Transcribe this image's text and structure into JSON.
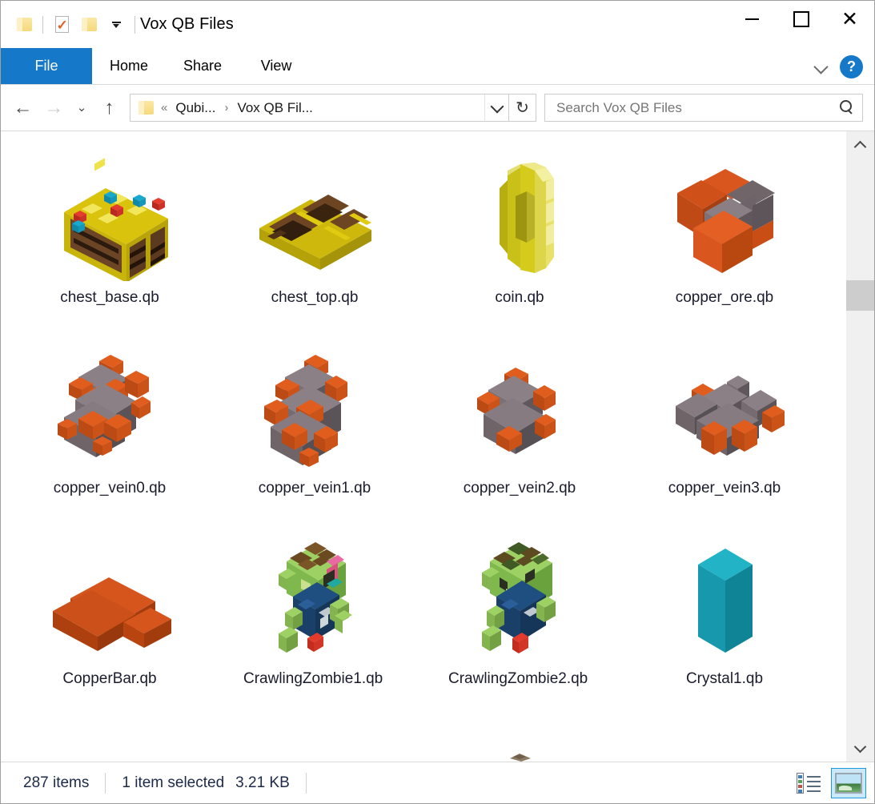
{
  "window": {
    "title": "Vox QB Files",
    "quick_access": [
      {
        "name": "folder-icon",
        "label": "Folder"
      },
      {
        "name": "properties-icon",
        "label": "Properties"
      },
      {
        "name": "new-folder-icon",
        "label": "New folder"
      },
      {
        "name": "customize-quick-access-caret",
        "label": "Customize Quick Access Toolbar"
      }
    ],
    "controls": {
      "minimize": "minimize-button",
      "maximize": "maximize-button",
      "close": "close-button"
    }
  },
  "ribbon": {
    "tabs": [
      {
        "label": "File",
        "active": true
      },
      {
        "label": "Home",
        "active": false
      },
      {
        "label": "Share",
        "active": false
      },
      {
        "label": "View",
        "active": false
      }
    ],
    "expand_label": "",
    "help_label": "?"
  },
  "navigation": {
    "back": "←",
    "forward": "→",
    "recent": "⌄",
    "up": "↑",
    "refresh": "↻"
  },
  "address": {
    "leading_chevrons": "«",
    "separator": "›",
    "crumbs": [
      "Qubi...",
      "Vox QB Fil..."
    ]
  },
  "search": {
    "placeholder": "Search Vox QB Files",
    "value": ""
  },
  "files": [
    {
      "name": "chest_base.qb",
      "icon": "voxel-chest-base",
      "selected": false
    },
    {
      "name": "chest_top.qb",
      "icon": "voxel-chest-top",
      "selected": false
    },
    {
      "name": "coin.qb",
      "icon": "voxel-coin",
      "selected": false
    },
    {
      "name": "copper_ore.qb",
      "icon": "voxel-copper-ore",
      "selected": false
    },
    {
      "name": "copper_vein0.qb",
      "icon": "voxel-copper-vein0",
      "selected": false
    },
    {
      "name": "copper_vein1.qb",
      "icon": "voxel-copper-vein1",
      "selected": false
    },
    {
      "name": "copper_vein2.qb",
      "icon": "voxel-copper-vein2",
      "selected": false
    },
    {
      "name": "copper_vein3.qb",
      "icon": "voxel-copper-vein3",
      "selected": false
    },
    {
      "name": "CopperBar.qb",
      "icon": "voxel-copper-bar",
      "selected": false
    },
    {
      "name": "CrawlingZombie1.qb",
      "icon": "voxel-zombie-1",
      "selected": false
    },
    {
      "name": "CrawlingZombie2.qb",
      "icon": "voxel-zombie-2",
      "selected": false
    },
    {
      "name": "Crystal1.qb",
      "icon": "voxel-crystal",
      "selected": false
    }
  ],
  "status": {
    "item_count": "287 items",
    "selection": "1 item selected",
    "size": "3.21 KB"
  },
  "view_toggle": {
    "details_label": "Details view",
    "large_icons_label": "Large icons view",
    "active": "large-icons"
  },
  "colors": {
    "accent": "#1678c8",
    "selection_highlight": "#cce8f7",
    "selection_border": "#1a9be0",
    "text": "#1b1b2e",
    "status_text": "#1b2a4a",
    "copper": "#d6551c",
    "stone": "#6e6360",
    "gold": "#d4c40d",
    "crystal": "#129eb4",
    "zombie_skin": "#8cc45a"
  }
}
